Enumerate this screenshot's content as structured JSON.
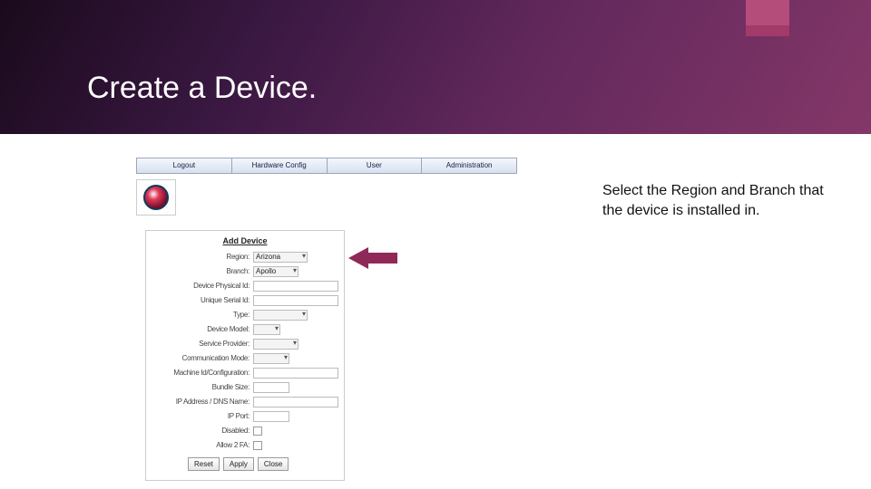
{
  "slide": {
    "title": "Create a Device."
  },
  "tabs": {
    "t1": "Logout",
    "t2": "Hardware Config",
    "t3": "User",
    "t4": "Administration"
  },
  "form": {
    "title": "Add Device",
    "labels": {
      "region": "Region:",
      "branch": "Branch:",
      "device_physical_id": "Device Physical Id:",
      "unique_serial_id": "Unique Serial Id:",
      "type": "Type:",
      "device_model": "Device Model:",
      "service_provider": "Service Provider:",
      "communication_mode": "Communication Mode:",
      "machine_configuration": "Machine Id/Configuration:",
      "bundle_size": "Bundle Size:",
      "ip_dns": "IP Address / DNS Name:",
      "ip_port": "IP Port:",
      "disabled": "Disabled:",
      "allow_2fa": "Allow 2 FA:"
    },
    "values": {
      "region": "Arizona",
      "branch": "Apollo"
    },
    "buttons": {
      "reset": "Reset",
      "apply": "Apply",
      "close": "Close"
    }
  },
  "instruction": {
    "pre": "Select the ",
    "kw1": "Region",
    "mid": " and ",
    "kw2": "Branch",
    "post": " that the device is installed in."
  }
}
